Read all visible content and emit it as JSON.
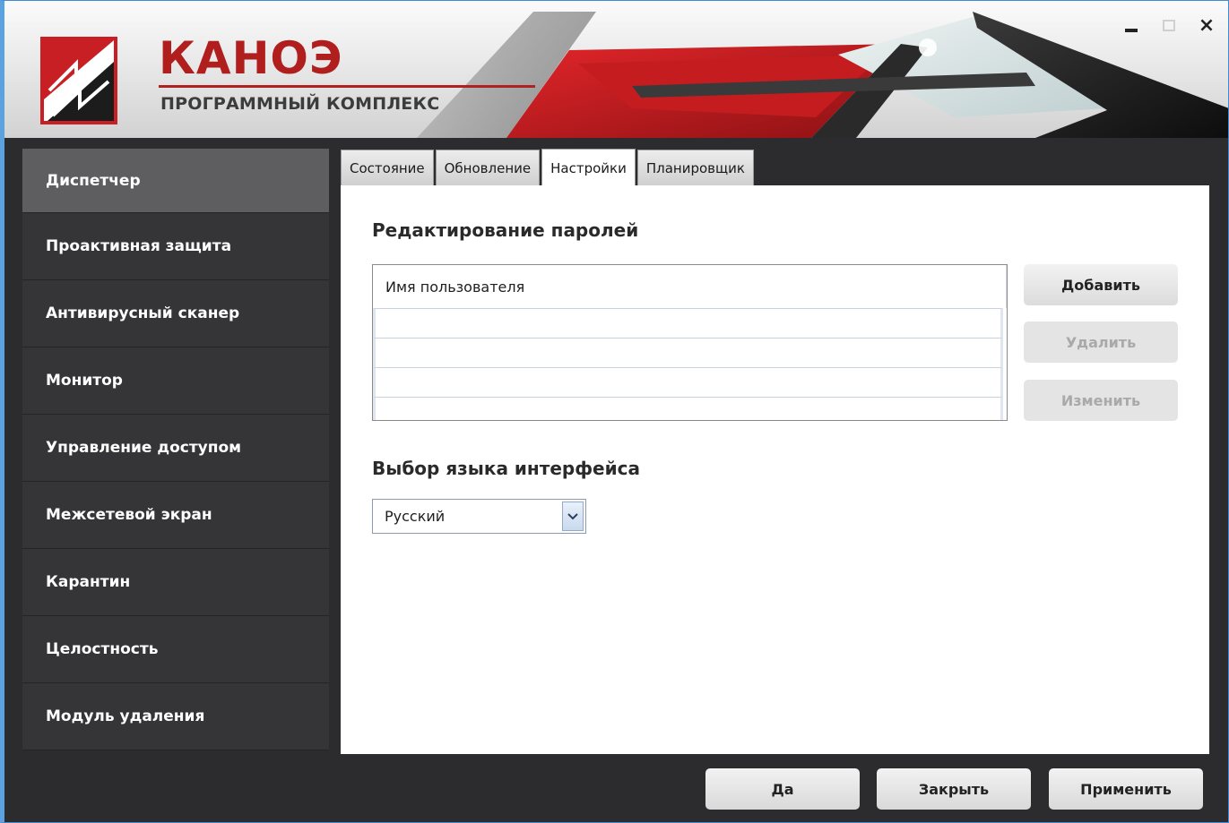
{
  "app": {
    "brand_name": "КАНОЭ",
    "brand_subtitle": "ПРОГРАММНЫЙ КОМПЛЕКС"
  },
  "window_controls": {
    "close_glyph": "×"
  },
  "sidebar": {
    "items": [
      {
        "label": "Диспетчер",
        "active": true
      },
      {
        "label": "Проактивная защита"
      },
      {
        "label": "Антивирусный сканер"
      },
      {
        "label": "Монитор"
      },
      {
        "label": "Управление доступом"
      },
      {
        "label": "Межсетевой экран"
      },
      {
        "label": "Карантин"
      },
      {
        "label": "Целостность"
      },
      {
        "label": "Модуль удаления"
      }
    ]
  },
  "tabs": [
    {
      "label": "Состояние"
    },
    {
      "label": "Обновление"
    },
    {
      "label": "Настройки",
      "active": true
    },
    {
      "label": "Планировщик"
    }
  ],
  "passwords": {
    "title": "Редактирование паролей",
    "column_header": "Имя пользователя",
    "rows": [
      "",
      "",
      "",
      ""
    ],
    "add_label": "Добавить",
    "delete_label": "Удалить",
    "edit_label": "Изменить"
  },
  "language": {
    "title": "Выбор языка интерфейса",
    "selected": "Русский"
  },
  "footer": {
    "yes_label": "Да",
    "close_label": "Закрыть",
    "apply_label": "Применить"
  },
  "colors": {
    "brand_red": "#b01e1e",
    "sidebar_bg": "#353537",
    "sidebar_active": "#5e5e60",
    "window_frame": "#5aa3e0"
  }
}
